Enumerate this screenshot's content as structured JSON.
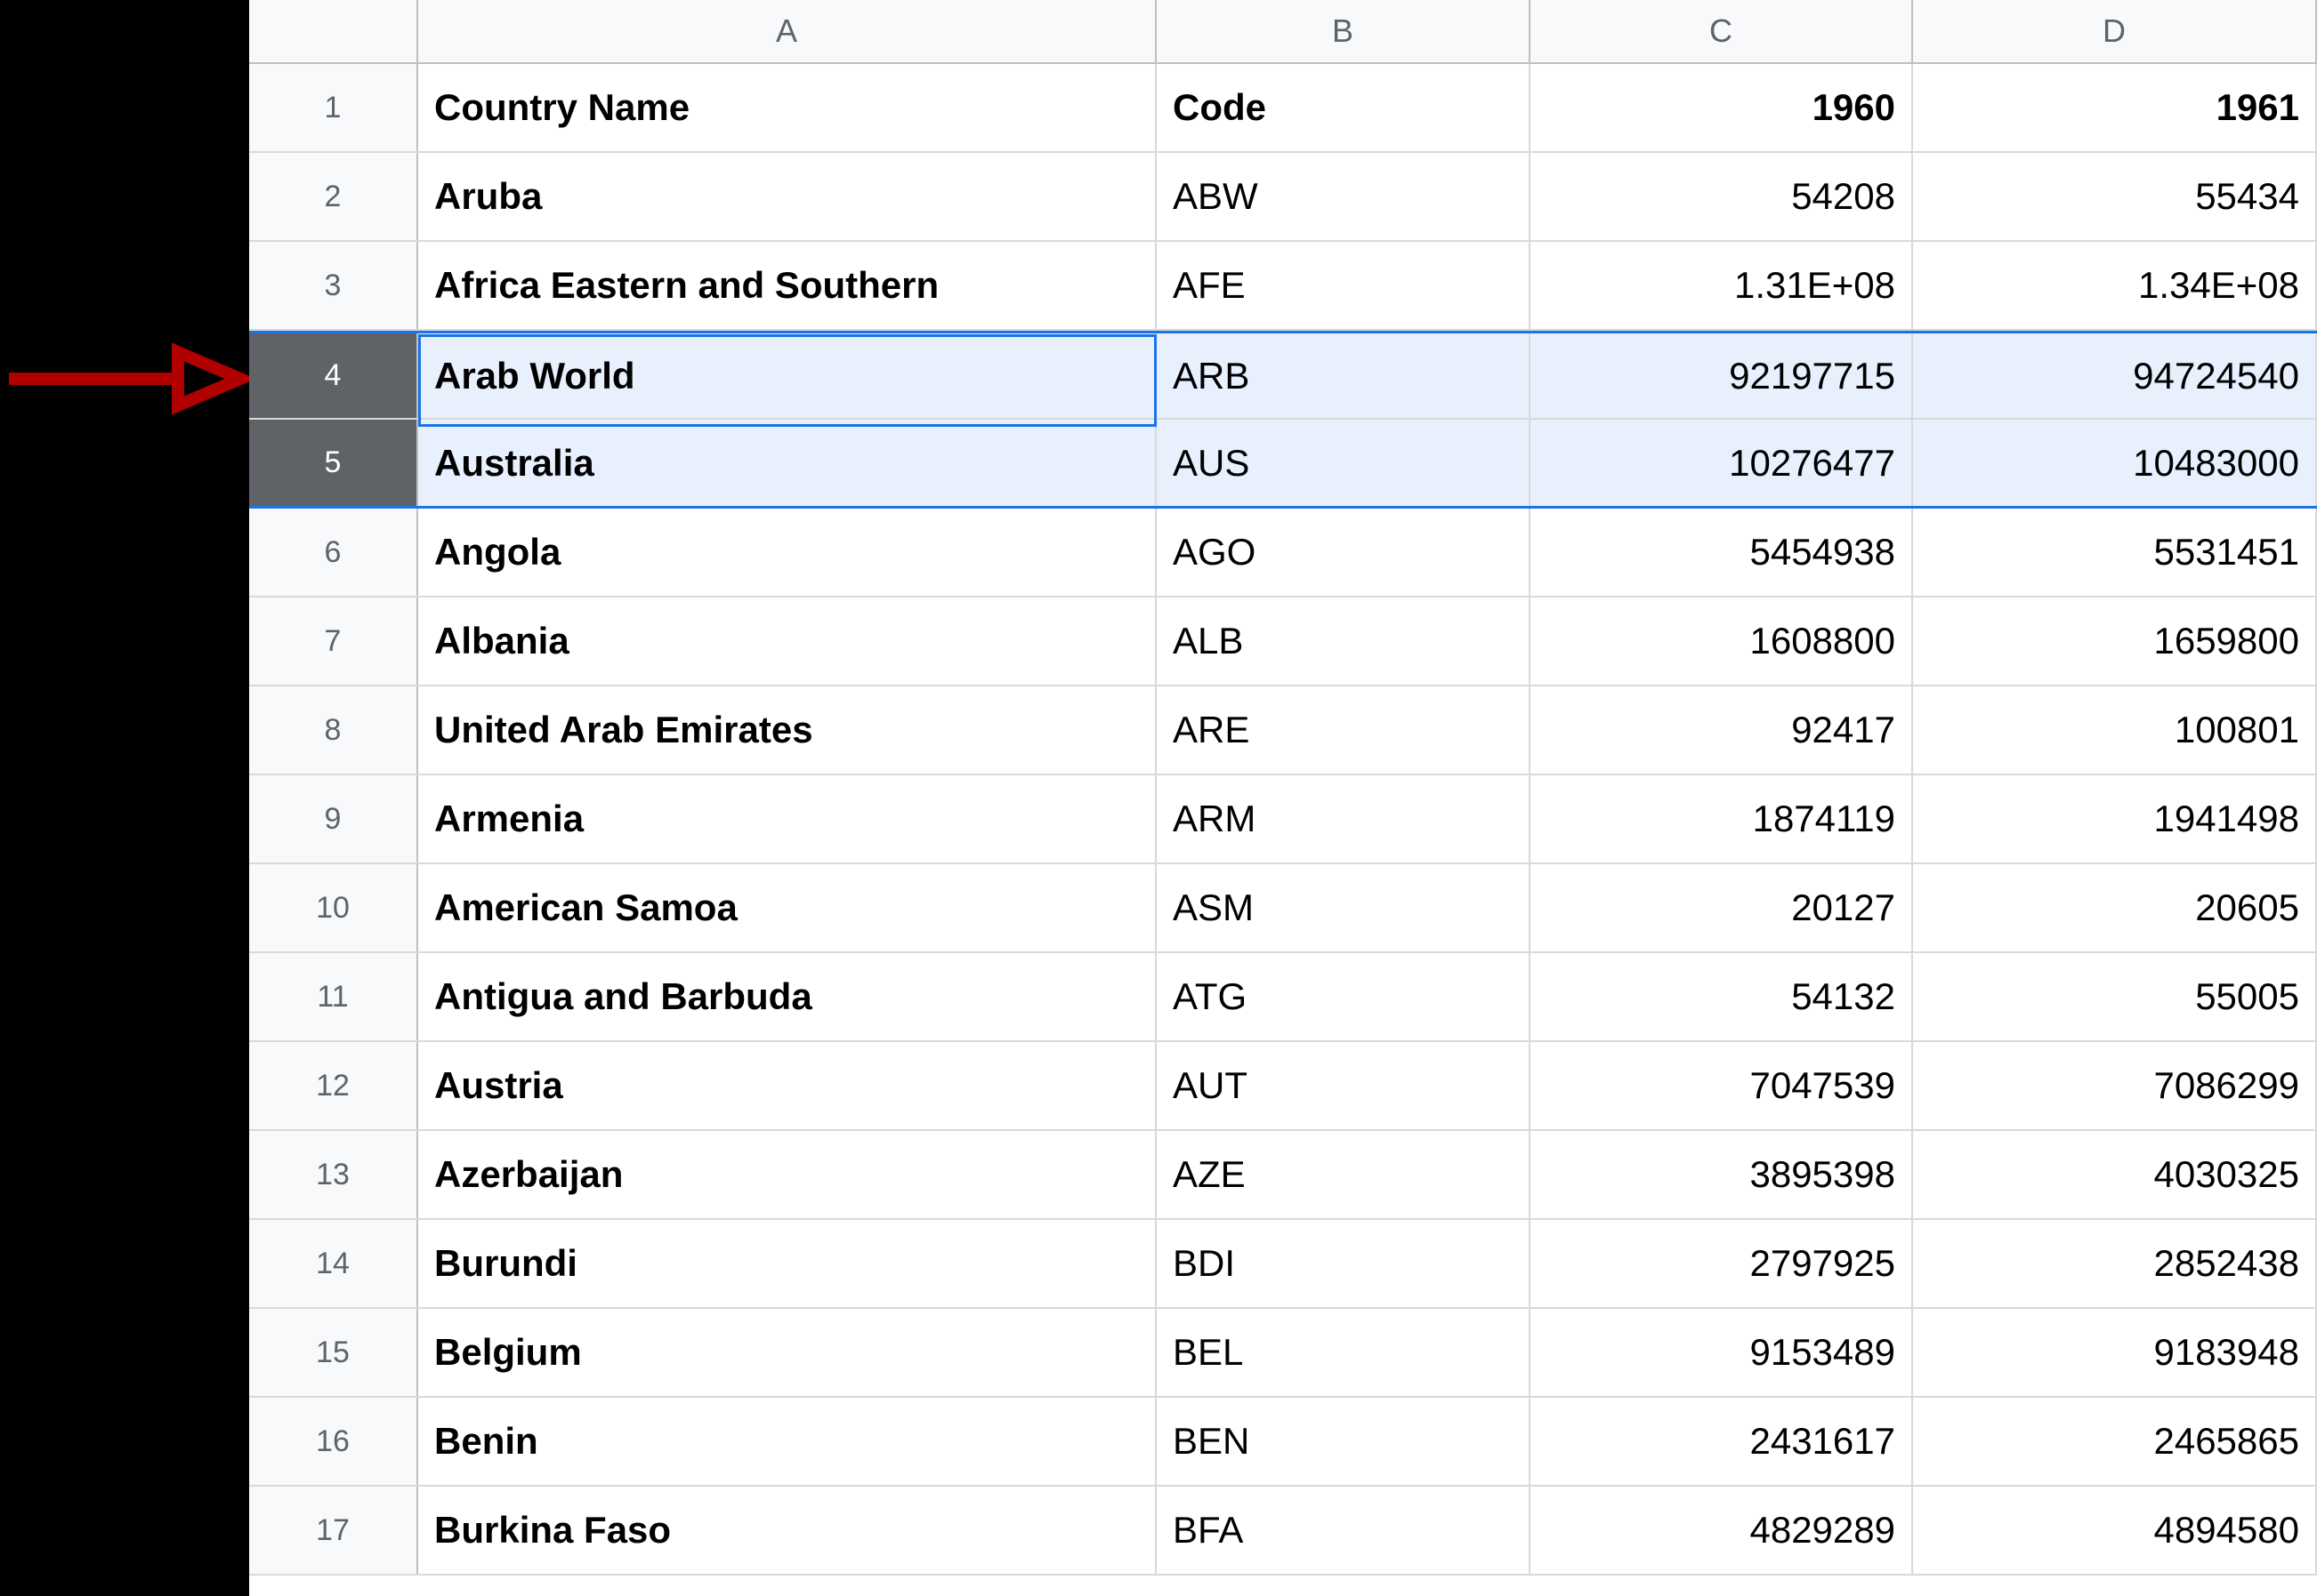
{
  "columns": {
    "A": "A",
    "B": "B",
    "C": "C",
    "D": "D"
  },
  "header": {
    "rownum": "1",
    "A": "Country Name",
    "B": "Code",
    "C": "1960",
    "D": "1961"
  },
  "rows": [
    {
      "rownum": "2",
      "A": "Aruba",
      "B": "ABW",
      "C": "54208",
      "D": "55434",
      "selected": false
    },
    {
      "rownum": "3",
      "A": "Africa Eastern and Southern",
      "B": "AFE",
      "C": "1.31E+08",
      "D": "1.34E+08",
      "selected": false
    },
    {
      "rownum": "4",
      "A": "Arab World",
      "B": "ARB",
      "C": "92197715",
      "D": "94724540",
      "selected": true,
      "active": true
    },
    {
      "rownum": "5",
      "A": "Australia",
      "B": "AUS",
      "C": "10276477",
      "D": "10483000",
      "selected": true
    },
    {
      "rownum": "6",
      "A": "Angola",
      "B": "AGO",
      "C": "5454938",
      "D": "5531451",
      "selected": false
    },
    {
      "rownum": "7",
      "A": "Albania",
      "B": "ALB",
      "C": "1608800",
      "D": "1659800",
      "selected": false
    },
    {
      "rownum": "8",
      "A": "United Arab Emirates",
      "B": "ARE",
      "C": "92417",
      "D": "100801",
      "selected": false
    },
    {
      "rownum": "9",
      "A": "Armenia",
      "B": "ARM",
      "C": "1874119",
      "D": "1941498",
      "selected": false
    },
    {
      "rownum": "10",
      "A": "American Samoa",
      "B": "ASM",
      "C": "20127",
      "D": "20605",
      "selected": false
    },
    {
      "rownum": "11",
      "A": "Antigua and Barbuda",
      "B": "ATG",
      "C": "54132",
      "D": "55005",
      "selected": false
    },
    {
      "rownum": "12",
      "A": "Austria",
      "B": "AUT",
      "C": "7047539",
      "D": "7086299",
      "selected": false
    },
    {
      "rownum": "13",
      "A": "Azerbaijan",
      "B": "AZE",
      "C": "3895398",
      "D": "4030325",
      "selected": false
    },
    {
      "rownum": "14",
      "A": "Burundi",
      "B": "BDI",
      "C": "2797925",
      "D": "2852438",
      "selected": false
    },
    {
      "rownum": "15",
      "A": "Belgium",
      "B": "BEL",
      "C": "9153489",
      "D": "9183948",
      "selected": false
    },
    {
      "rownum": "16",
      "A": "Benin",
      "B": "BEN",
      "C": "2431617",
      "D": "2465865",
      "selected": false
    },
    {
      "rownum": "17",
      "A": "Burkina Faso",
      "B": "BFA",
      "C": "4829289",
      "D": "4894580",
      "selected": false
    }
  ],
  "annotation": {
    "arrow_color": "#b00000"
  },
  "chart_data": {
    "type": "table",
    "title": "",
    "columns": [
      "Country Name",
      "Code",
      "1960",
      "1961"
    ],
    "rows": [
      [
        "Aruba",
        "ABW",
        54208,
        55434
      ],
      [
        "Africa Eastern and Southern",
        "AFE",
        131000000.0,
        134000000.0
      ],
      [
        "Arab World",
        "ARB",
        92197715,
        94724540
      ],
      [
        "Australia",
        "AUS",
        10276477,
        10483000
      ],
      [
        "Angola",
        "AGO",
        5454938,
        5531451
      ],
      [
        "Albania",
        "ALB",
        1608800,
        1659800
      ],
      [
        "United Arab Emirates",
        "ARE",
        92417,
        100801
      ],
      [
        "Armenia",
        "ARM",
        1874119,
        1941498
      ],
      [
        "American Samoa",
        "ASM",
        20127,
        20605
      ],
      [
        "Antigua and Barbuda",
        "ATG",
        54132,
        55005
      ],
      [
        "Austria",
        "AUT",
        7047539,
        7086299
      ],
      [
        "Azerbaijan",
        "AZE",
        3895398,
        4030325
      ],
      [
        "Burundi",
        "BDI",
        2797925,
        2852438
      ],
      [
        "Belgium",
        "BEL",
        9153489,
        9183948
      ],
      [
        "Benin",
        "BEN",
        2431617,
        2465865
      ],
      [
        "Burkina Faso",
        "BFA",
        4829289,
        4894580
      ]
    ]
  }
}
